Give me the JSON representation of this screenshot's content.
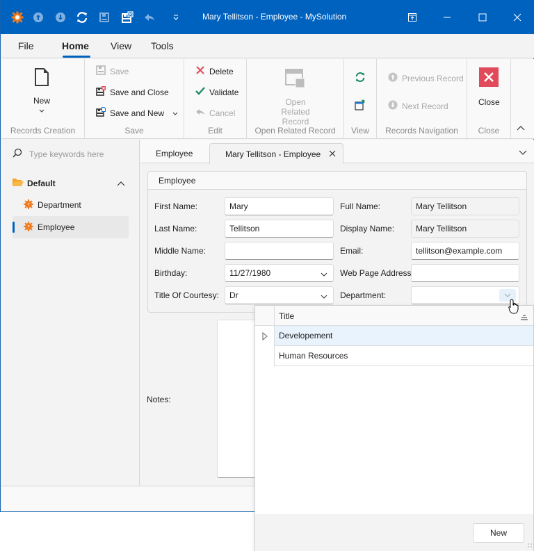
{
  "window": {
    "title": "Mary Tellitson - Employee - MySolution",
    "accent_color": "#0062bf"
  },
  "quick_access": {
    "icons": [
      "app-logo-icon",
      "previous-record-icon",
      "next-record-icon",
      "refresh-icon",
      "save-icon",
      "save-and-close-icon",
      "cancel-icon",
      "customize-toolbar-icon"
    ]
  },
  "menu": {
    "tabs": [
      {
        "label": "File",
        "active": false
      },
      {
        "label": "Home",
        "active": true
      },
      {
        "label": "View",
        "active": false
      },
      {
        "label": "Tools",
        "active": false
      }
    ]
  },
  "ribbon": {
    "groups": {
      "records_creation": {
        "label": "Records Creation",
        "new_label": "New"
      },
      "save": {
        "label": "Save",
        "save": "Save",
        "save_and_close": "Save and Close",
        "save_and_new": "Save and New"
      },
      "edit": {
        "label": "Edit",
        "delete": "Delete",
        "validate": "Validate",
        "cancel": "Cancel"
      },
      "open_related": {
        "label": "Open Related Record",
        "button": "Open Related Record"
      },
      "view": {
        "label": "View"
      },
      "navigation": {
        "label": "Records Navigation",
        "previous": "Previous Record",
        "next": "Next Record"
      },
      "close": {
        "label": "Close",
        "button": "Close"
      }
    }
  },
  "sidebar": {
    "search_placeholder": "Type keywords here",
    "group_label": "Default",
    "items": [
      {
        "label": "Department",
        "selected": false
      },
      {
        "label": "Employee",
        "selected": true
      }
    ]
  },
  "tabs": [
    {
      "label": "Employee",
      "active": false
    },
    {
      "label": "Mary Tellitson - Employee",
      "active": true
    }
  ],
  "form": {
    "group_title": "Employee",
    "fields_left": [
      {
        "label": "First Name:",
        "value": "Mary"
      },
      {
        "label": "Last Name:",
        "value": "Tellitson"
      },
      {
        "label": "Middle Name:",
        "value": ""
      },
      {
        "label": "Birthday:",
        "value": "11/27/1980"
      },
      {
        "label": "Title Of Courtesy:",
        "value": "Dr"
      }
    ],
    "fields_right": [
      {
        "label": "Full Name:",
        "value": "Mary Tellitson"
      },
      {
        "label": "Display Name:",
        "value": "Mary Tellitson"
      },
      {
        "label": "Email:",
        "value": "tellitson@example.com"
      },
      {
        "label": "Web Page Address:",
        "value": ""
      },
      {
        "label": "Department:",
        "value": ""
      }
    ],
    "notes_label": "Notes:",
    "notes_value": ""
  },
  "lookup_popup": {
    "column_header": "Title",
    "rows": [
      "Developement",
      "Human Resources"
    ],
    "focused_row": 0,
    "new_button": "New"
  }
}
